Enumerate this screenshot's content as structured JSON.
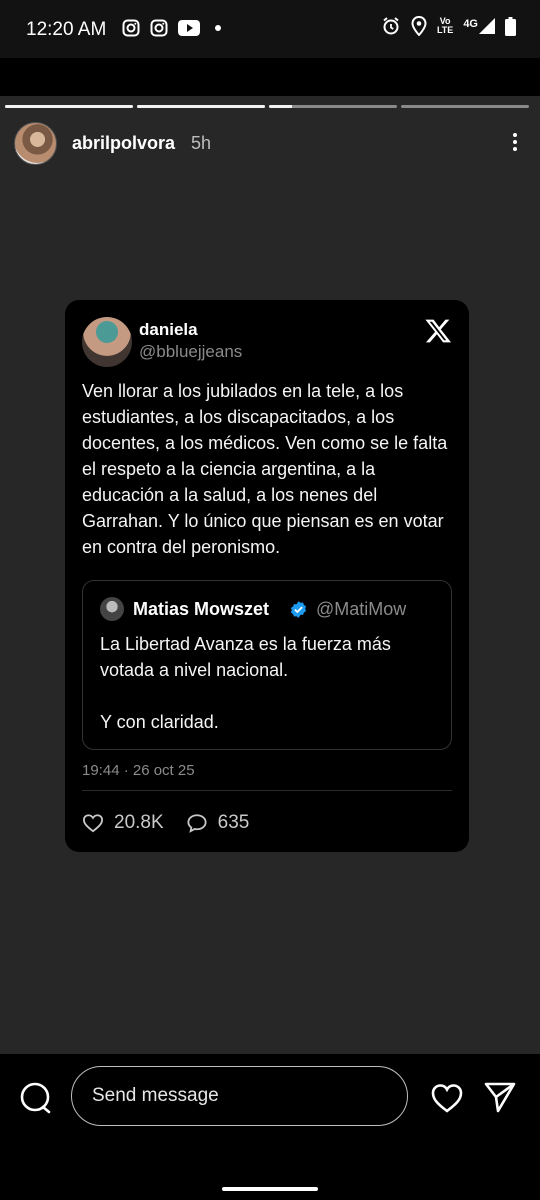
{
  "status_bar": {
    "time": "12:20 AM",
    "app_icons": [
      "instagram-icon",
      "instagram-icon",
      "youtube-icon",
      "notification-dot"
    ],
    "right_icons": [
      "alarm-icon",
      "location-icon",
      "volte-icon",
      "signal-4g-icon",
      "battery-icon"
    ],
    "network": "4G",
    "volte_top": "Vo",
    "volte_bottom": "LTE"
  },
  "story": {
    "progress": [
      1.0,
      1.0,
      0.18,
      0.0
    ],
    "username": "abrilpolvora",
    "time_ago": "5h"
  },
  "tweet": {
    "name": "daniela",
    "handle": "@bbluejjeans",
    "text": "Ven llorar a los jubilados en la tele, a los estudiantes, a los discapacitados, a los docentes, a los médicos. Ven como se le falta el respeto a la ciencia argentina, a la educación a la salud, a los nenes del Garrahan. Y lo único que piensan es en votar en contra del peronismo.",
    "quote": {
      "name": "Matias Mowszet",
      "handle": "@MatiMow",
      "text": "La Libertad Avanza es la fuerza más votada a nivel nacional.\n\nY con claridad."
    },
    "date": "19:44 · 26 oct 25",
    "likes": "20.8K",
    "replies": "635"
  },
  "bottom_bar": {
    "message_placeholder": "Send message"
  },
  "colors": {
    "story_background": "#272727",
    "tweet_card": "#000000",
    "verified": "#1d9bf0"
  }
}
